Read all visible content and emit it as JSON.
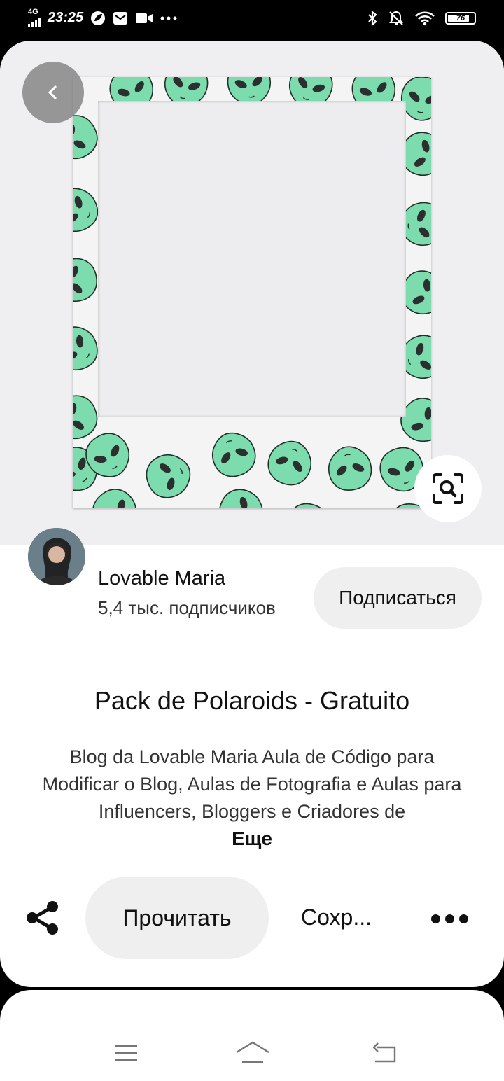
{
  "status_bar": {
    "network": "4G",
    "time": "23:25",
    "battery": "76"
  },
  "author": {
    "name": "Lovable Maria",
    "followers": "5,4 тыс. подписчиков",
    "subscribe_label": "Подписаться"
  },
  "pin": {
    "title": "Pack de Polaroids - Gratuito",
    "description": "Blog da Lovable Maria Aula de Código para Modificar o Blog, Aulas de Fotografia e Aulas para Influencers, Bloggers e Criadores de",
    "more_label": "Еще"
  },
  "actions": {
    "read_label": "Прочитать",
    "save_label": "Сохр..."
  },
  "icons": {
    "back": "chevron-left-icon",
    "visual_search": "lens-search-icon",
    "share": "share-icon",
    "more": "more-dots-icon"
  },
  "colors": {
    "alien_green": "#7ddcae",
    "button_bg": "#efefef",
    "text": "#111111"
  }
}
